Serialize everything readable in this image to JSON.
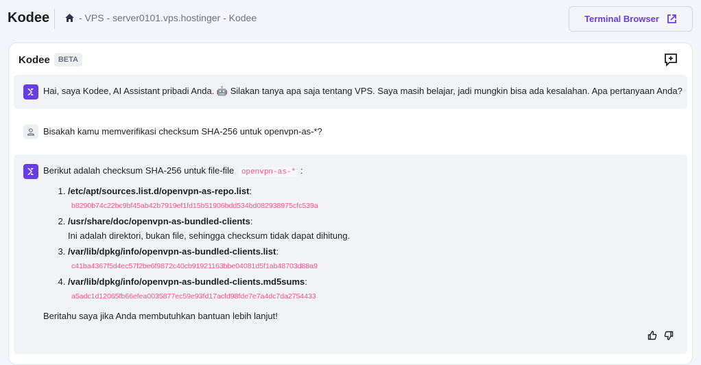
{
  "header": {
    "title": "Kodee",
    "breadcrumb": "- VPS - server0101.vps.hostinger - Kodee",
    "terminal_button": "Terminal Browser"
  },
  "chat": {
    "title": "Kodee",
    "badge": "BETA",
    "greeting": "Hai, saya Kodee, AI Assistant pribadi Anda. 🤖 Silakan tanya apa saja tentang VPS. Saya masih belajar, jadi mungkin bisa ada kesalahan. Apa pertanyaan Anda?",
    "user_message": "Bisakah kamu memverifikasi checksum SHA-256 untuk openvpn-as-*?",
    "reply": {
      "intro": "Berikut adalah checksum SHA-256 untuk file-file",
      "intro_code": "openvpn-as-*",
      "intro_end": ":",
      "items": [
        {
          "path": "/etc/apt/sources.list.d/openvpn-as-repo.list",
          "detail": "b8290b74c22bc9bf45ab42b7919ef1fd15b51906bdd534bd082938975cfc539a",
          "is_hash": true
        },
        {
          "path": "/usr/share/doc/openvpn-as-bundled-clients",
          "detail": "Ini adalah direktori, bukan file, sehingga checksum tidak dapat dihitung.",
          "is_hash": false
        },
        {
          "path": "/var/lib/dpkg/info/openvpn-as-bundled-clients.list",
          "detail": "c41ba4367f5d4ec57f2be6f9872c40cb91921163bbe04081d5f1ab48703d88a9",
          "is_hash": true
        },
        {
          "path": "/var/lib/dpkg/info/openvpn-as-bundled-clients.md5sums",
          "detail": "a5adc1d12065fb66efea0035877ec59e93fd17acfd98fde7e7a4dc7da2754433",
          "is_hash": true
        }
      ],
      "outro": "Beritahu saya jika Anda membutuhkan bantuan lebih lanjut!"
    }
  },
  "colors": {
    "accent": "#673de6",
    "code": "#fc5185"
  }
}
